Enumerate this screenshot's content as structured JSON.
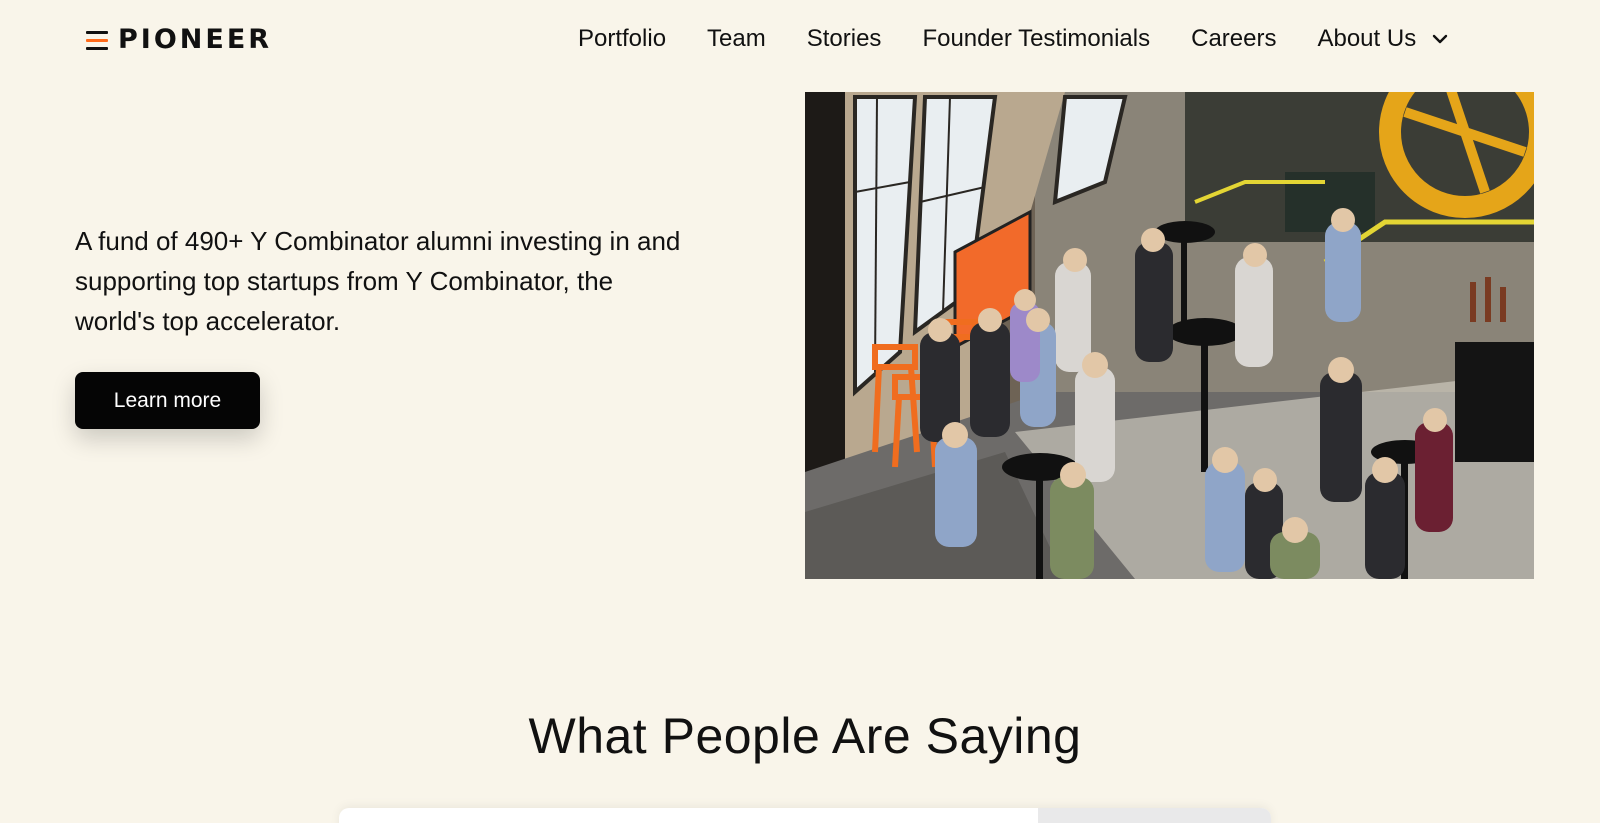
{
  "brand": {
    "logo_text": "PIONEER",
    "accent": "#ff6a1a"
  },
  "nav": {
    "items": [
      {
        "label": "Portfolio"
      },
      {
        "label": "Team"
      },
      {
        "label": "Stories"
      },
      {
        "label": "Founder Testimonials"
      },
      {
        "label": "Careers"
      }
    ],
    "about": {
      "label": "About Us",
      "icon": "chevron-down-icon"
    }
  },
  "hero": {
    "description": "A fund of 490+ Y Combinator alumni investing in and supporting top startups from Y Combinator, the world's top accelerator.",
    "cta_label": "Learn more"
  },
  "testimonials": {
    "title": "What People Are Saying"
  },
  "colors": {
    "background": "#f9f5ea",
    "button": "#050505"
  }
}
